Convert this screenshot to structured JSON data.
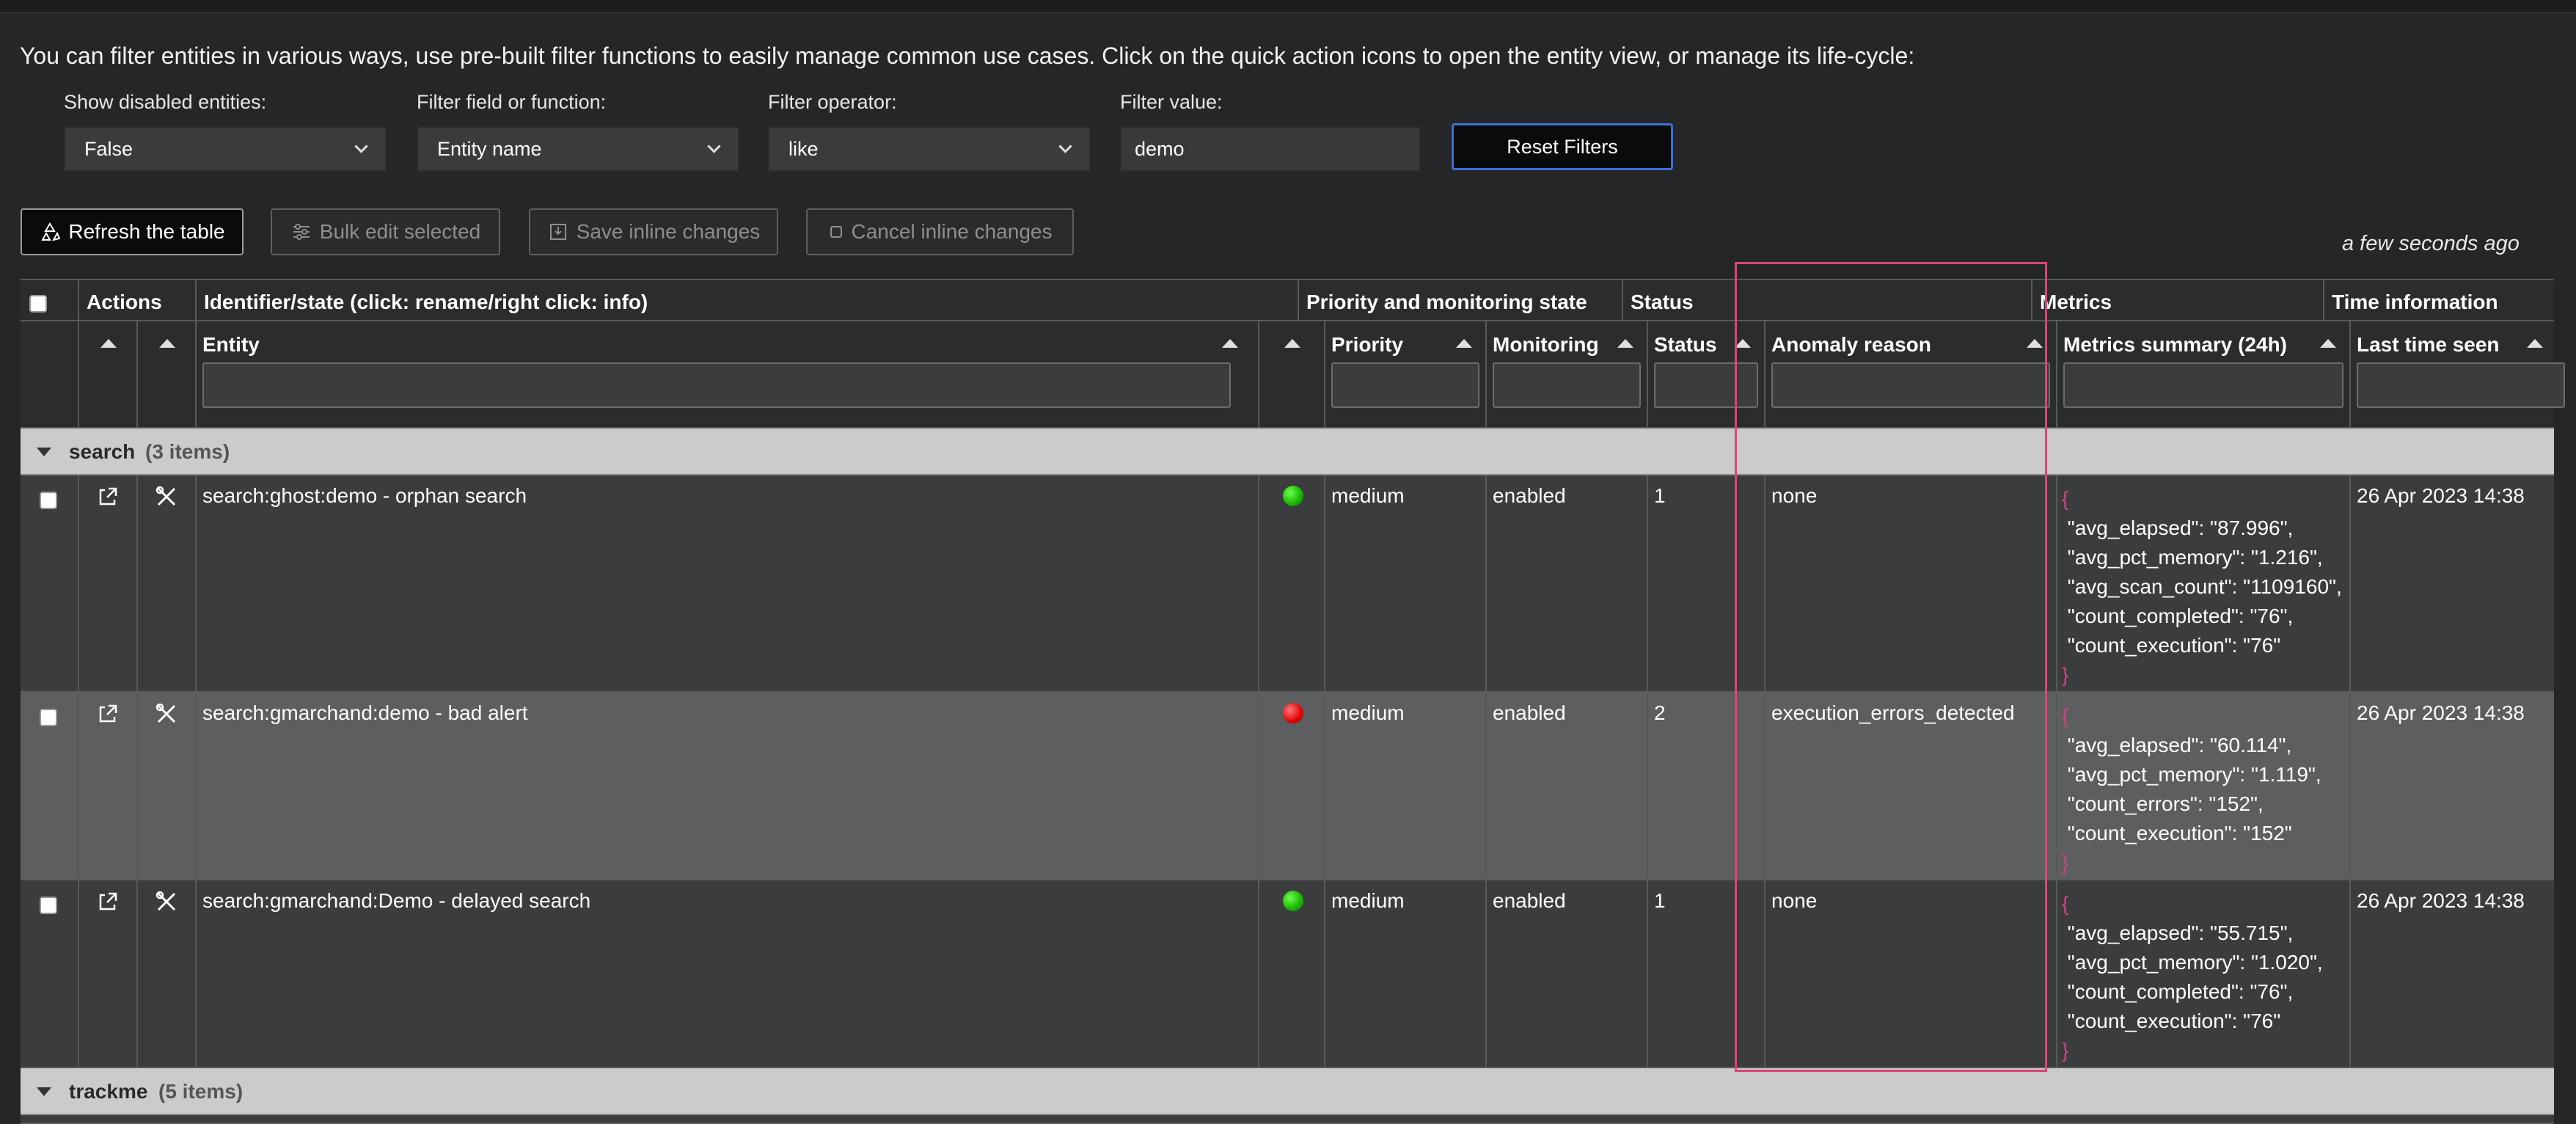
{
  "intro_text": "You can filter entities in various ways, use pre-built filter functions to easily manage common use cases. Click on the quick action icons to open the entity view, or manage its life-cycle:",
  "filters": {
    "show_disabled": {
      "label": "Show disabled entities:",
      "value": "False"
    },
    "field": {
      "label": "Filter field or function:",
      "value": "Entity name"
    },
    "operator": {
      "label": "Filter operator:",
      "value": "like"
    },
    "value": {
      "label": "Filter value:",
      "value": "demo"
    },
    "reset_label": "Reset Filters"
  },
  "toolbar": {
    "refresh": "Refresh the table",
    "bulk_edit": "Bulk edit selected",
    "save_inline": "Save inline changes",
    "cancel_inline": "Cancel inline changes"
  },
  "last_refresh": "a few seconds ago",
  "header_groups": {
    "actions": "Actions",
    "identifier": "Identifier/state (click: rename/right click: info)",
    "priority_state": "Priority and monitoring state",
    "status": "Status",
    "metrics": "Metrics",
    "time": "Time information"
  },
  "columns": {
    "entity": "Entity",
    "priority": "Priority",
    "monitoring": "Monitoring",
    "status": "Status",
    "anomaly": "Anomaly reason",
    "metrics_summary": "Metrics summary (24h)",
    "last_seen": "Last time seen"
  },
  "groups": [
    {
      "name": "search",
      "count": "(3 items)",
      "rows": [
        {
          "entity": "search:ghost:demo - orphan search",
          "state_color": "green",
          "priority": "medium",
          "monitoring": "enabled",
          "status": "1",
          "anomaly": "none",
          "metrics": [
            "\"avg_elapsed\": \"87.996\",",
            "\"avg_pct_memory\": \"1.216\",",
            "\"avg_scan_count\": \"1109160\",",
            "\"count_completed\": \"76\",",
            "\"count_execution\": \"76\""
          ],
          "last_seen": "26 Apr 2023 14:38"
        },
        {
          "entity": "search:gmarchand:demo - bad alert",
          "state_color": "red",
          "priority": "medium",
          "monitoring": "enabled",
          "status": "2",
          "anomaly": "execution_errors_detected",
          "metrics": [
            "\"avg_elapsed\": \"60.114\",",
            "\"avg_pct_memory\": \"1.119\",",
            "\"count_errors\": \"152\",",
            "\"count_execution\": \"152\""
          ],
          "last_seen": "26 Apr 2023 14:38"
        },
        {
          "entity": "search:gmarchand:Demo - delayed search",
          "state_color": "green",
          "priority": "medium",
          "monitoring": "enabled",
          "status": "1",
          "anomaly": "none",
          "metrics": [
            "\"avg_elapsed\": \"55.715\",",
            "\"avg_pct_memory\": \"1.020\",",
            "\"count_completed\": \"76\",",
            "\"count_execution\": \"76\""
          ],
          "last_seen": "26 Apr 2023 14:38"
        }
      ]
    },
    {
      "name": "trackme",
      "count": "(5 items)",
      "rows": []
    }
  ],
  "json_open": "{",
  "json_close": "}",
  "colors": {
    "accent_border": "#3d6ed8",
    "highlight_box": "#d9467a",
    "green": "#16b300",
    "red": "#e30000"
  }
}
